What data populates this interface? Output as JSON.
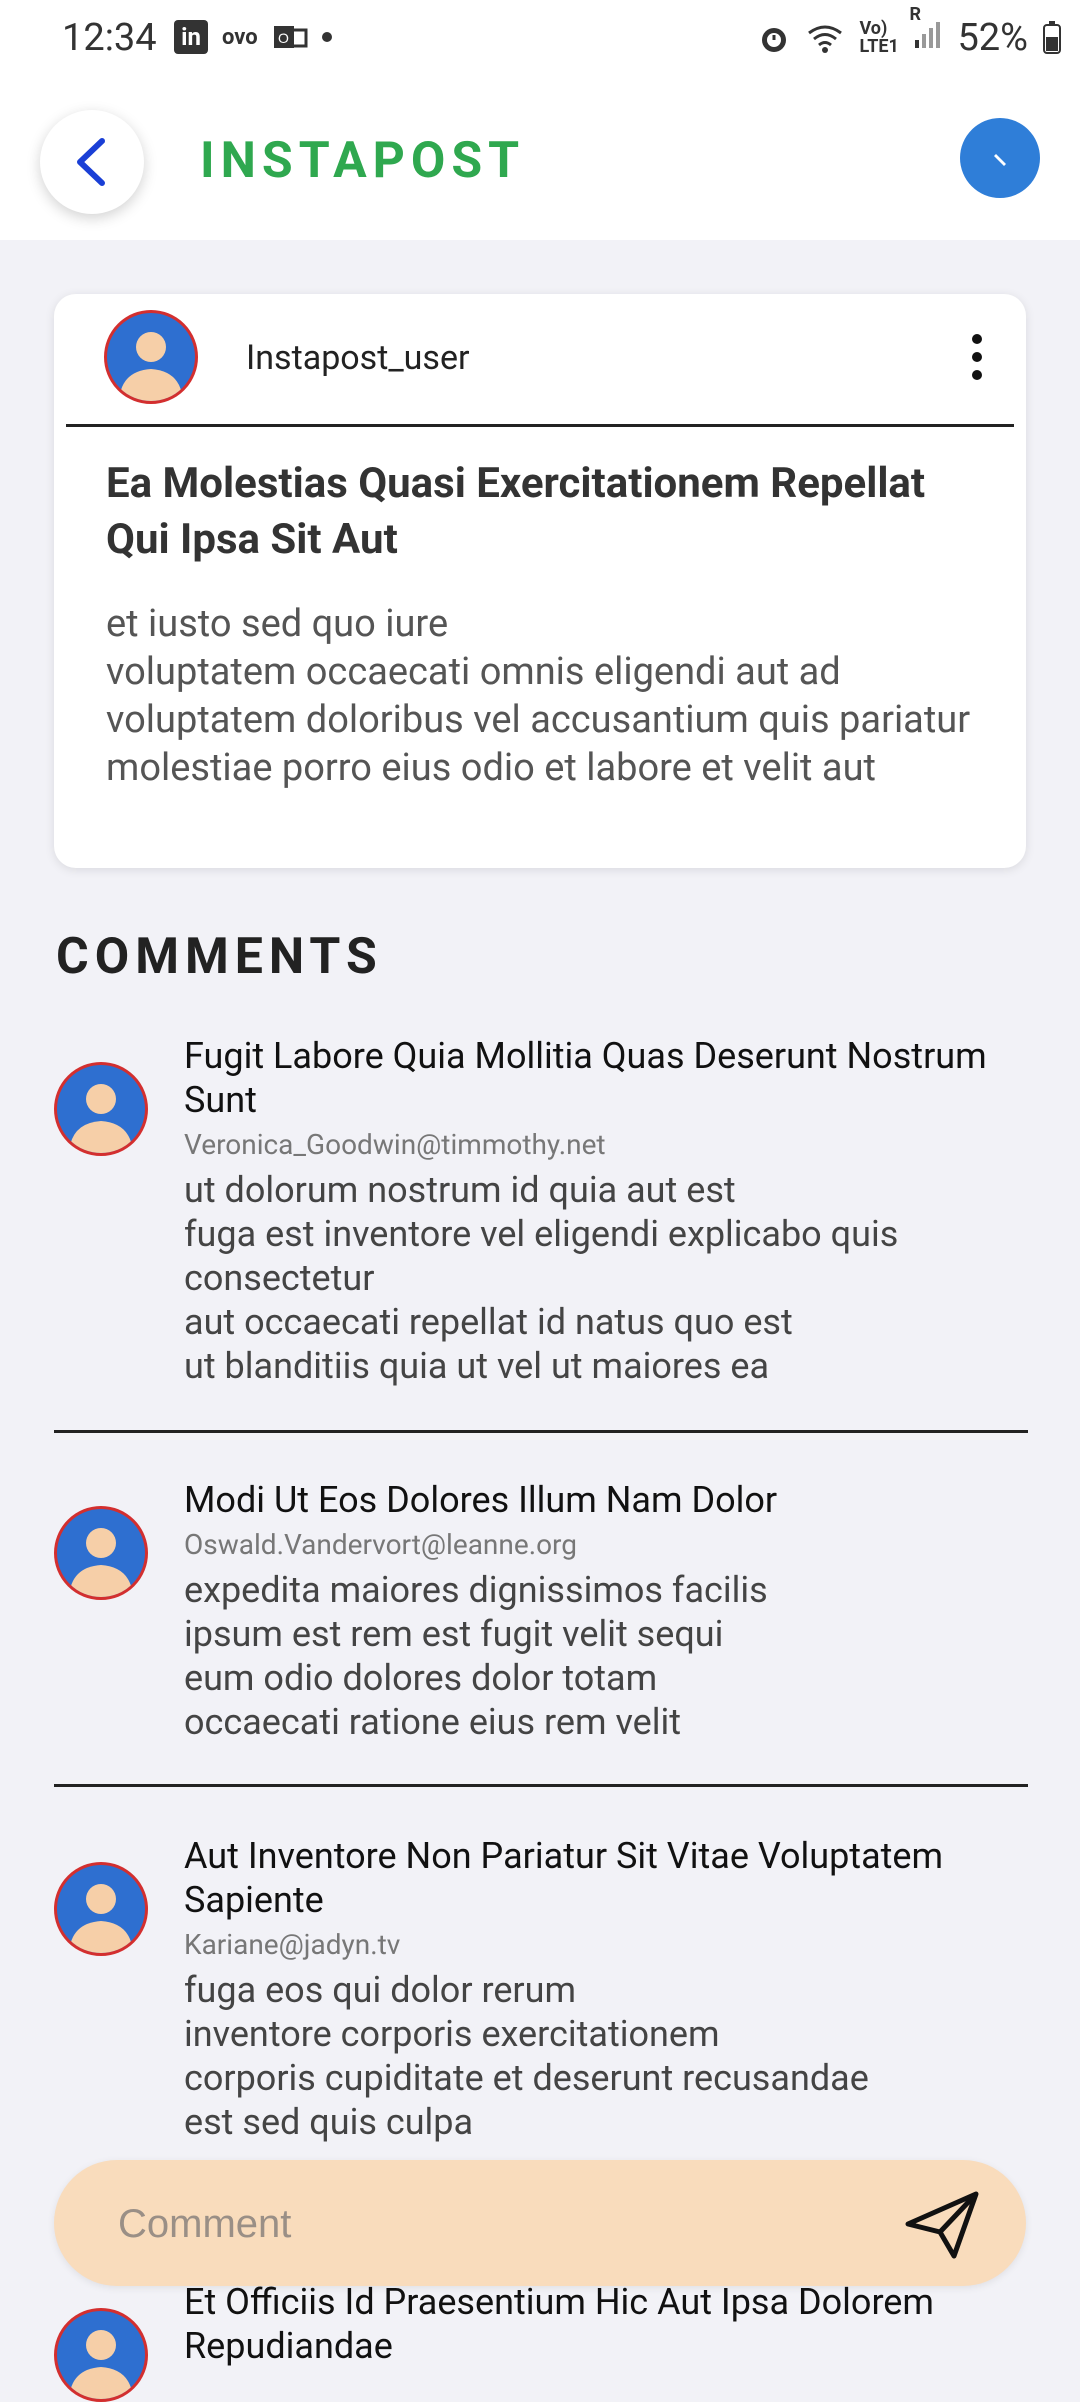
{
  "status_bar": {
    "time": "12:34",
    "battery": "52%",
    "network_label": "Vo) LTE1",
    "lte_label": "R"
  },
  "app_bar": {
    "title": "INSTAPOST"
  },
  "post": {
    "username": "Instapost_user",
    "title": "Ea Molestias Quasi Exercitationem Repellat Qui Ipsa Sit Aut",
    "body": "et iusto sed quo iure\nvoluptatem occaecati omnis eligendi aut ad\nvoluptatem doloribus vel accusantium quis pariatur\nmolestiae porro eius odio et labore et velit aut"
  },
  "comments_heading": "COMMENTS",
  "comments": [
    {
      "name": "Fugit Labore Quia Mollitia Quas Deserunt Nostrum Sunt",
      "email": "Veronica_Goodwin@timmothy.net",
      "body": "ut dolorum nostrum id quia aut est\nfuga est inventore vel eligendi explicabo quis consectetur\naut occaecati repellat id natus quo est\nut blanditiis quia ut vel ut maiores ea"
    },
    {
      "name": "Modi Ut Eos Dolores Illum Nam Dolor",
      "email": "Oswald.Vandervort@leanne.org",
      "body": "expedita maiores dignissimos facilis\nipsum est rem est fugit velit sequi\neum odio dolores dolor totam\noccaecati ratione eius rem velit"
    },
    {
      "name": "Aut Inventore Non Pariatur Sit Vitae Voluptatem Sapiente",
      "email": "Kariane@jadyn.tv",
      "body": "fuga eos qui dolor rerum\ninventore corporis exercitationem\ncorporis cupiditate et deserunt recusandae\nest sed quis culpa"
    },
    {
      "name": "Et Officiis Id Praesentium Hic Aut Ipsa Dolorem Repudiandae",
      "email": "",
      "body": ""
    }
  ],
  "comment_input": {
    "placeholder": "Comment"
  },
  "colors": {
    "accent_green": "#2fa84f",
    "messenger_blue": "#2f7ed8",
    "input_bg": "#f9dcbc",
    "avatar_border": "#d32f2f"
  }
}
